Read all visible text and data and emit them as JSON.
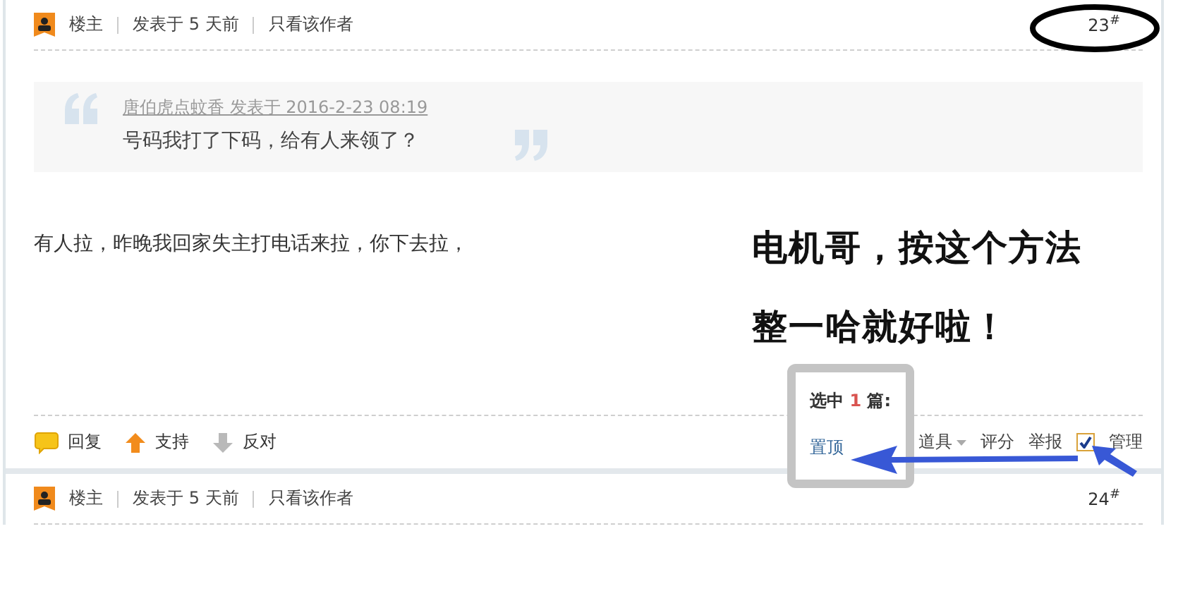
{
  "posts": [
    {
      "header": {
        "role": "楼主",
        "posted": "发表于 5 天前",
        "only_author": "只看该作者",
        "floor": "23$^{#}$",
        "floor_circled": true
      },
      "quote": {
        "author_line": "唐伯虎点蚊香 发表于 2016-2-23 08:19",
        "text": "号码我打了下码，给有人来领了？"
      },
      "body": "有人拉，昨晚我回家失主打电话来拉，你下去拉，",
      "actions": [
        {
          "kind": "reply",
          "label": "回复"
        },
        {
          "kind": "support",
          "label": "支持"
        },
        {
          "kind": "oppose",
          "label": "反对"
        }
      ],
      "tools": [
        {
          "label": "道具",
          "has_menu": true
        },
        {
          "label": "评分",
          "has_menu": false
        },
        {
          "label": "举报",
          "has_menu": false
        }
      ],
      "manage": {
        "label": "管理",
        "checked": true
      }
    },
    {
      "header": {
        "role": "楼主",
        "posted": "发表于 5 天前",
        "only_author": "只看该作者",
        "floor": "24$^{#}$",
        "floor_circled": false
      }
    }
  ],
  "popup": {
    "prefix": "选中",
    "count": "1",
    "suffix": "篇:",
    "action": "置顶"
  },
  "annotation": {
    "lines": [
      "电机哥，按这个方法",
      "整一哈就好啦！"
    ]
  }
}
